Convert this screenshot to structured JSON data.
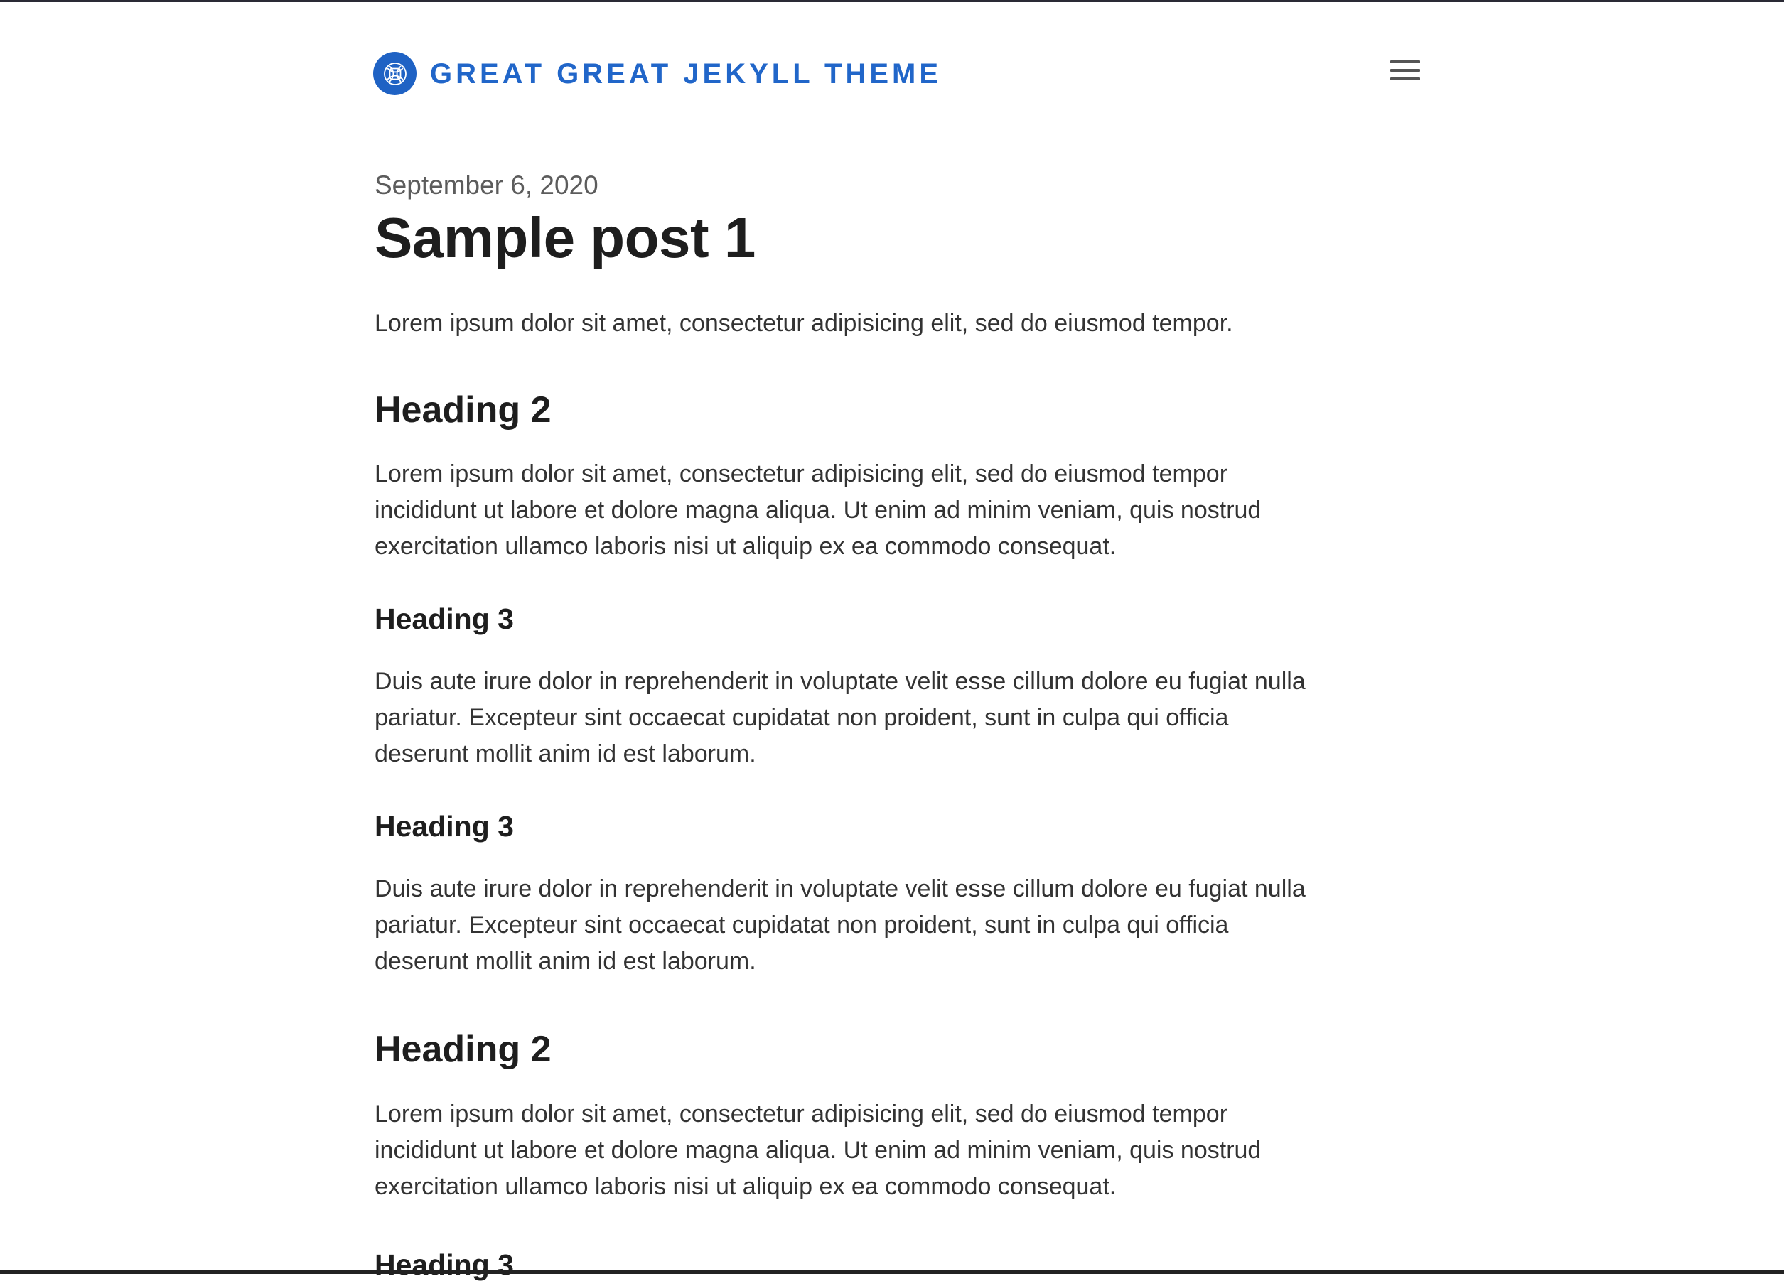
{
  "site": {
    "name": "GREAT GREAT JEKYLL THEME",
    "accent_color": "#2166c9",
    "logo_icon": "knot-icon"
  },
  "header": {
    "menu_icon": "hamburger-menu-icon"
  },
  "post": {
    "date": "September 6, 2020",
    "title": "Sample post 1",
    "intro": "Lorem ipsum dolor sit amet, consectetur adipisicing elit, sed do eiusmod tempor.",
    "sections": [
      {
        "heading": "Heading 2",
        "text": "Lorem ipsum dolor sit amet, consectetur adipisicing elit, sed do eiusmod tempor incididunt ut labore et dolore magna aliqua. Ut enim ad minim veniam, quis nostrud exercitation ullamco laboris nisi ut aliquip ex ea commodo consequat."
      },
      {
        "heading": "Heading 3",
        "text": "Duis aute irure dolor in reprehenderit in voluptate velit esse cillum dolore eu fugiat nulla pariatur. Excepteur sint occaecat cupidatat non proident, sunt in culpa qui officia deserunt mollit anim id est laborum."
      },
      {
        "heading": "Heading 3",
        "text": "Duis aute irure dolor in reprehenderit in voluptate velit esse cillum dolore eu fugiat nulla pariatur. Excepteur sint occaecat cupidatat non proident, sunt in culpa qui officia deserunt mollit anim id est laborum."
      },
      {
        "heading": "Heading 2",
        "text": "Lorem ipsum dolor sit amet, consectetur adipisicing elit, sed do eiusmod tempor incididunt ut labore et dolore magna aliqua. Ut enim ad minim veniam, quis nostrud exercitation ullamco laboris nisi ut aliquip ex ea commodo consequat."
      },
      {
        "heading": "Heading 3"
      }
    ]
  }
}
